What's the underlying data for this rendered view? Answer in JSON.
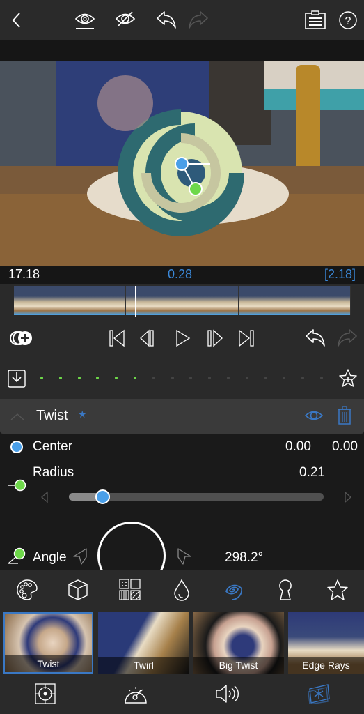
{
  "topbar": {
    "icons": [
      "back-icon",
      "show-effect-icon",
      "hide-effect-icon",
      "undo-icon",
      "redo-icon",
      "clipboard-icon",
      "help-icon"
    ],
    "help_glyph": "?"
  },
  "preview": {
    "center_handle_color": "#4a9fe8",
    "radius_handle_color": "#6ed84a"
  },
  "timebar": {
    "current_time": "17.18",
    "effect_time": "0.28",
    "duration": "[2.18]"
  },
  "timeline": {
    "frame_count": 6,
    "playhead_position_fraction": 0.36
  },
  "transport": {
    "icons": [
      "add-layer-icon",
      "jump-to-start-icon",
      "step-back-icon",
      "play-icon",
      "step-forward-icon",
      "jump-to-end-icon",
      "undo-icon",
      "redo-icon"
    ]
  },
  "keyframes": {
    "active_count": 6,
    "total_count": 16,
    "active_color": "#6ed84a",
    "inactive_color": "#444444"
  },
  "effect": {
    "name": "Twist",
    "favorite_glyph": "★",
    "accent": "#3a78c4"
  },
  "params": {
    "center": {
      "label": "Center",
      "x": "0.00",
      "y": "0.00"
    },
    "radius": {
      "label": "Radius",
      "value": "0.21",
      "slider_fraction": 0.13
    },
    "angle": {
      "label": "Angle",
      "value": "298.2°"
    }
  },
  "fx_tabs": {
    "items": [
      "palette-icon",
      "cube-icon",
      "pattern-icon",
      "drop-icon",
      "spiral-icon",
      "keyhole-icon",
      "star-icon"
    ],
    "active": "spiral-icon"
  },
  "presets": [
    {
      "label": "Twist",
      "selected": true
    },
    {
      "label": "Twirl",
      "selected": false
    },
    {
      "label": "Big Twist",
      "selected": false
    },
    {
      "label": "Edge Rays",
      "selected": false
    }
  ],
  "bottom_nav": {
    "items": [
      "crop-target-icon",
      "speed-gauge-icon",
      "audio-icon",
      "effects-icon"
    ],
    "active": "effects-icon"
  }
}
